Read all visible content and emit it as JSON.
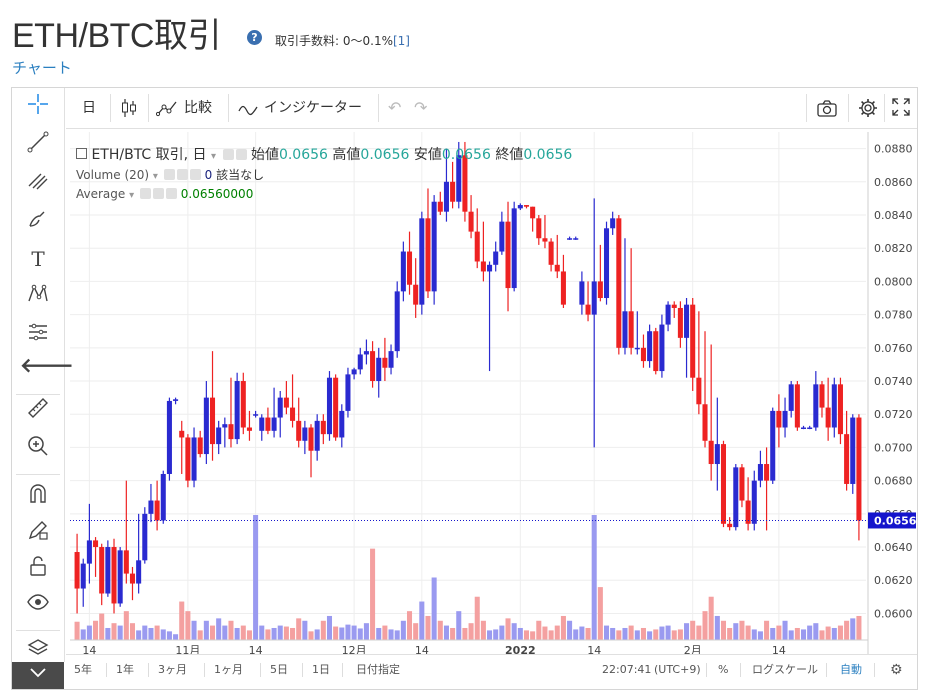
{
  "header": {
    "pair_title": "ETH/BTC取引",
    "help_icon": "?",
    "fee_label": "取引手数料: 0～0.1%",
    "fee_ref": "[1]",
    "chart_link": "チャート"
  },
  "toolbar": {
    "interval": "日",
    "compare": "比較",
    "indicators": "インジケーター"
  },
  "legend": {
    "symbol": "ETH/BTC 取引, 日",
    "open_label": "始値",
    "open_value": "0.0656",
    "high_label": "高値",
    "high_value": "0.0656",
    "low_label": "安値",
    "low_value": "0.0656",
    "close_label": "終値",
    "close_value": "0.0656",
    "volume_label": "Volume (20)",
    "volume_value": "0",
    "volume_na": "該当なし",
    "average_label": "Average",
    "average_value": "0.06560000"
  },
  "bottombar": {
    "ranges": [
      "5年",
      "1年",
      "3ヶ月",
      "1ヶ月",
      "5日",
      "1日"
    ],
    "date_range": "日付指定",
    "time": "22:07:41",
    "timezone": "(UTC+9)",
    "percent": "%",
    "log_scale": "ログスケール",
    "auto": "自動"
  },
  "colors": {
    "up": "#2a2ad0",
    "down": "#ee2222",
    "vol_up": "#9a9af0",
    "vol_down": "#f4a0a0",
    "last_price_tag": "#1515cc",
    "link": "#2a7fc0"
  },
  "chart_data": {
    "type": "candlestick",
    "y_range": [
      0.0584,
      0.089
    ],
    "y_ticks": [
      "0.0880",
      "0.0860",
      "0.0840",
      "0.0820",
      "0.0800",
      "0.0780",
      "0.0760",
      "0.0740",
      "0.0720",
      "0.0700",
      "0.0680",
      "0.0660",
      "0.0640",
      "0.0620",
      "0.0600"
    ],
    "last_price": "0.0656",
    "x_ticks": [
      "14",
      "11月",
      "14",
      "12月",
      "14",
      "2022",
      "14",
      "2月",
      "14"
    ],
    "candles": [
      {
        "o": 0.0637,
        "h": 0.0648,
        "l": 0.06,
        "c": 0.0615,
        "v": 38
      },
      {
        "o": 0.0615,
        "h": 0.0633,
        "l": 0.0604,
        "c": 0.063,
        "v": 22
      },
      {
        "o": 0.063,
        "h": 0.0666,
        "l": 0.0618,
        "c": 0.0644,
        "v": 30
      },
      {
        "o": 0.0644,
        "h": 0.0646,
        "l": 0.0622,
        "c": 0.064,
        "v": 40
      },
      {
        "o": 0.064,
        "h": 0.0642,
        "l": 0.0605,
        "c": 0.0612,
        "v": 55
      },
      {
        "o": 0.0612,
        "h": 0.0644,
        "l": 0.061,
        "c": 0.064,
        "v": 25
      },
      {
        "o": 0.064,
        "h": 0.0645,
        "l": 0.06,
        "c": 0.0606,
        "v": 35
      },
      {
        "o": 0.0606,
        "h": 0.064,
        "l": 0.0604,
        "c": 0.0638,
        "v": 30
      },
      {
        "o": 0.0638,
        "h": 0.068,
        "l": 0.0618,
        "c": 0.0624,
        "v": 60
      },
      {
        "o": 0.0624,
        "h": 0.0628,
        "l": 0.0608,
        "c": 0.0618,
        "v": 35
      },
      {
        "o": 0.0618,
        "h": 0.066,
        "l": 0.0612,
        "c": 0.0632,
        "v": 20
      },
      {
        "o": 0.0632,
        "h": 0.0664,
        "l": 0.063,
        "c": 0.066,
        "v": 30
      },
      {
        "o": 0.066,
        "h": 0.0678,
        "l": 0.0655,
        "c": 0.0668,
        "v": 25
      },
      {
        "o": 0.0668,
        "h": 0.068,
        "l": 0.065,
        "c": 0.0656,
        "v": 30
      },
      {
        "o": 0.0656,
        "h": 0.0686,
        "l": 0.0654,
        "c": 0.0684,
        "v": 22
      },
      {
        "o": 0.0684,
        "h": 0.073,
        "l": 0.068,
        "c": 0.0728,
        "v": 18
      },
      {
        "o": 0.0728,
        "h": 0.073,
        "l": 0.0726,
        "c": 0.0729,
        "v": 12
      },
      {
        "o": 0.071,
        "h": 0.0716,
        "l": 0.0684,
        "c": 0.0706,
        "v": 80
      },
      {
        "o": 0.0706,
        "h": 0.0708,
        "l": 0.0676,
        "c": 0.068,
        "v": 60
      },
      {
        "o": 0.068,
        "h": 0.0712,
        "l": 0.0676,
        "c": 0.0706,
        "v": 40
      },
      {
        "o": 0.0706,
        "h": 0.071,
        "l": 0.0694,
        "c": 0.0696,
        "v": 20
      },
      {
        "o": 0.0696,
        "h": 0.074,
        "l": 0.069,
        "c": 0.073,
        "v": 40
      },
      {
        "o": 0.073,
        "h": 0.0758,
        "l": 0.0692,
        "c": 0.0702,
        "v": 30
      },
      {
        "o": 0.0702,
        "h": 0.0716,
        "l": 0.0696,
        "c": 0.0712,
        "v": 45
      },
      {
        "o": 0.0712,
        "h": 0.0718,
        "l": 0.07,
        "c": 0.0714,
        "v": 30
      },
      {
        "o": 0.0714,
        "h": 0.0742,
        "l": 0.07,
        "c": 0.0705,
        "v": 40
      },
      {
        "o": 0.0705,
        "h": 0.0745,
        "l": 0.0702,
        "c": 0.074,
        "v": 25
      },
      {
        "o": 0.074,
        "h": 0.0745,
        "l": 0.0708,
        "c": 0.0712,
        "v": 30
      },
      {
        "o": 0.0712,
        "h": 0.0722,
        "l": 0.0704,
        "c": 0.071,
        "v": 20
      },
      {
        "o": 0.072,
        "h": 0.0722,
        "l": 0.0718,
        "c": 0.072,
        "v": 260
      },
      {
        "o": 0.071,
        "h": 0.072,
        "l": 0.0704,
        "c": 0.0718,
        "v": 30
      },
      {
        "o": 0.0718,
        "h": 0.0724,
        "l": 0.0708,
        "c": 0.071,
        "v": 22
      },
      {
        "o": 0.071,
        "h": 0.0736,
        "l": 0.0706,
        "c": 0.0718,
        "v": 25
      },
      {
        "o": 0.0718,
        "h": 0.0734,
        "l": 0.0706,
        "c": 0.073,
        "v": 30
      },
      {
        "o": 0.073,
        "h": 0.074,
        "l": 0.072,
        "c": 0.0724,
        "v": 28
      },
      {
        "o": 0.0724,
        "h": 0.0744,
        "l": 0.0712,
        "c": 0.0716,
        "v": 25
      },
      {
        "o": 0.0716,
        "h": 0.073,
        "l": 0.07,
        "c": 0.0704,
        "v": 45
      },
      {
        "o": 0.0704,
        "h": 0.0716,
        "l": 0.0696,
        "c": 0.0712,
        "v": 40
      },
      {
        "o": 0.0712,
        "h": 0.0714,
        "l": 0.0682,
        "c": 0.0698,
        "v": 18
      },
      {
        "o": 0.0698,
        "h": 0.072,
        "l": 0.0692,
        "c": 0.0716,
        "v": 22
      },
      {
        "o": 0.0716,
        "h": 0.072,
        "l": 0.0702,
        "c": 0.0708,
        "v": 40
      },
      {
        "o": 0.0708,
        "h": 0.0746,
        "l": 0.0704,
        "c": 0.0742,
        "v": 50
      },
      {
        "o": 0.0742,
        "h": 0.0744,
        "l": 0.0704,
        "c": 0.0706,
        "v": 28
      },
      {
        "o": 0.0706,
        "h": 0.0726,
        "l": 0.07,
        "c": 0.0722,
        "v": 26
      },
      {
        "o": 0.0722,
        "h": 0.0748,
        "l": 0.0718,
        "c": 0.0744,
        "v": 32
      },
      {
        "o": 0.0744,
        "h": 0.0748,
        "l": 0.0741,
        "c": 0.0747,
        "v": 30
      },
      {
        "o": 0.0747,
        "h": 0.076,
        "l": 0.0744,
        "c": 0.0756,
        "v": 24
      },
      {
        "o": 0.0756,
        "h": 0.0765,
        "l": 0.075,
        "c": 0.0758,
        "v": 35
      },
      {
        "o": 0.0758,
        "h": 0.0764,
        "l": 0.0736,
        "c": 0.074,
        "v": 190
      },
      {
        "o": 0.074,
        "h": 0.076,
        "l": 0.073,
        "c": 0.0754,
        "v": 25
      },
      {
        "o": 0.0754,
        "h": 0.0766,
        "l": 0.074,
        "c": 0.0748,
        "v": 30
      },
      {
        "o": 0.0748,
        "h": 0.0762,
        "l": 0.0744,
        "c": 0.0758,
        "v": 22
      },
      {
        "o": 0.0758,
        "h": 0.08,
        "l": 0.0754,
        "c": 0.0794,
        "v": 20
      },
      {
        "o": 0.0794,
        "h": 0.0824,
        "l": 0.0788,
        "c": 0.0818,
        "v": 40
      },
      {
        "o": 0.0818,
        "h": 0.083,
        "l": 0.0792,
        "c": 0.0798,
        "v": 60
      },
      {
        "o": 0.0798,
        "h": 0.0814,
        "l": 0.0778,
        "c": 0.0786,
        "v": 35
      },
      {
        "o": 0.0786,
        "h": 0.0842,
        "l": 0.078,
        "c": 0.0838,
        "v": 80
      },
      {
        "o": 0.0838,
        "h": 0.0856,
        "l": 0.079,
        "c": 0.0794,
        "v": 50
      },
      {
        "o": 0.0794,
        "h": 0.0852,
        "l": 0.0786,
        "c": 0.0848,
        "v": 130
      },
      {
        "o": 0.0848,
        "h": 0.0854,
        "l": 0.084,
        "c": 0.0842,
        "v": 40
      },
      {
        "o": 0.0842,
        "h": 0.088,
        "l": 0.0836,
        "c": 0.086,
        "v": 30
      },
      {
        "o": 0.086,
        "h": 0.0872,
        "l": 0.0844,
        "c": 0.0848,
        "v": 25
      },
      {
        "o": 0.0848,
        "h": 0.0884,
        "l": 0.0844,
        "c": 0.0876,
        "v": 60
      },
      {
        "o": 0.0876,
        "h": 0.0884,
        "l": 0.0836,
        "c": 0.0842,
        "v": 25
      },
      {
        "o": 0.0842,
        "h": 0.0852,
        "l": 0.0826,
        "c": 0.083,
        "v": 35
      },
      {
        "o": 0.083,
        "h": 0.0844,
        "l": 0.0808,
        "c": 0.0812,
        "v": 90
      },
      {
        "o": 0.0812,
        "h": 0.0836,
        "l": 0.08,
        "c": 0.0806,
        "v": 40
      },
      {
        "o": 0.0806,
        "h": 0.0812,
        "l": 0.0746,
        "c": 0.081,
        "v": 20
      },
      {
        "o": 0.081,
        "h": 0.0824,
        "l": 0.0806,
        "c": 0.0818,
        "v": 22
      },
      {
        "o": 0.0818,
        "h": 0.0842,
        "l": 0.0816,
        "c": 0.0836,
        "v": 30
      },
      {
        "o": 0.0836,
        "h": 0.0848,
        "l": 0.0782,
        "c": 0.0796,
        "v": 45
      },
      {
        "o": 0.0796,
        "h": 0.0848,
        "l": 0.0794,
        "c": 0.0844,
        "v": 35
      },
      {
        "o": 0.0844,
        "h": 0.0847,
        "l": 0.0843,
        "c": 0.0846,
        "v": 25
      },
      {
        "o": 0.0846,
        "h": 0.0846,
        "l": 0.0844,
        "c": 0.0845,
        "v": 20
      },
      {
        "o": 0.0845,
        "h": 0.0845,
        "l": 0.083,
        "c": 0.0838,
        "v": 18
      },
      {
        "o": 0.0838,
        "h": 0.084,
        "l": 0.0822,
        "c": 0.0826,
        "v": 40
      },
      {
        "o": 0.0826,
        "h": 0.084,
        "l": 0.082,
        "c": 0.0824,
        "v": 28
      },
      {
        "o": 0.0824,
        "h": 0.0826,
        "l": 0.0806,
        "c": 0.081,
        "v": 20
      },
      {
        "o": 0.081,
        "h": 0.0828,
        "l": 0.0802,
        "c": 0.0806,
        "v": 30
      },
      {
        "o": 0.0806,
        "h": 0.0816,
        "l": 0.0784,
        "c": 0.0786,
        "v": 50
      },
      {
        "o": 0.0826,
        "h": 0.0827,
        "l": 0.0825,
        "c": 0.0826,
        "v": 40
      },
      {
        "o": 0.0826,
        "h": 0.0827,
        "l": 0.0825,
        "c": 0.0826,
        "v": 22
      },
      {
        "o": 0.0786,
        "h": 0.0806,
        "l": 0.078,
        "c": 0.08,
        "v": 28
      },
      {
        "o": 0.0786,
        "h": 0.08,
        "l": 0.0776,
        "c": 0.078,
        "v": 25
      },
      {
        "o": 0.078,
        "h": 0.085,
        "l": 0.07,
        "c": 0.08,
        "v": 260
      },
      {
        "o": 0.08,
        "h": 0.0822,
        "l": 0.0788,
        "c": 0.079,
        "v": 110
      },
      {
        "o": 0.079,
        "h": 0.0836,
        "l": 0.0786,
        "c": 0.0832,
        "v": 30
      },
      {
        "o": 0.0832,
        "h": 0.0842,
        "l": 0.0828,
        "c": 0.0838,
        "v": 25
      },
      {
        "o": 0.0838,
        "h": 0.084,
        "l": 0.0756,
        "c": 0.076,
        "v": 20
      },
      {
        "o": 0.076,
        "h": 0.0826,
        "l": 0.0756,
        "c": 0.0782,
        "v": 25
      },
      {
        "o": 0.0782,
        "h": 0.082,
        "l": 0.0756,
        "c": 0.076,
        "v": 30
      },
      {
        "o": 0.076,
        "h": 0.0782,
        "l": 0.0756,
        "c": 0.076,
        "v": 20
      },
      {
        "o": 0.076,
        "h": 0.0768,
        "l": 0.0748,
        "c": 0.0752,
        "v": 25
      },
      {
        "o": 0.0752,
        "h": 0.0774,
        "l": 0.0748,
        "c": 0.077,
        "v": 18
      },
      {
        "o": 0.077,
        "h": 0.0772,
        "l": 0.0744,
        "c": 0.0746,
        "v": 22
      },
      {
        "o": 0.0746,
        "h": 0.078,
        "l": 0.0742,
        "c": 0.0774,
        "v": 28
      },
      {
        "o": 0.0774,
        "h": 0.0788,
        "l": 0.077,
        "c": 0.0786,
        "v": 30
      },
      {
        "o": 0.0786,
        "h": 0.0788,
        "l": 0.0778,
        "c": 0.0784,
        "v": 20
      },
      {
        "o": 0.0784,
        "h": 0.0788,
        "l": 0.076,
        "c": 0.0766,
        "v": 22
      },
      {
        "o": 0.0766,
        "h": 0.079,
        "l": 0.0742,
        "c": 0.0786,
        "v": 35
      },
      {
        "o": 0.0786,
        "h": 0.079,
        "l": 0.0734,
        "c": 0.0742,
        "v": 40
      },
      {
        "o": 0.0742,
        "h": 0.0782,
        "l": 0.072,
        "c": 0.0726,
        "v": 30
      },
      {
        "o": 0.0726,
        "h": 0.077,
        "l": 0.07,
        "c": 0.0704,
        "v": 60
      },
      {
        "o": 0.0704,
        "h": 0.0762,
        "l": 0.068,
        "c": 0.069,
        "v": 90
      },
      {
        "o": 0.069,
        "h": 0.073,
        "l": 0.0674,
        "c": 0.0702,
        "v": 50
      },
      {
        "o": 0.0702,
        "h": 0.0704,
        "l": 0.0652,
        "c": 0.0654,
        "v": 40
      },
      {
        "o": 0.0654,
        "h": 0.0658,
        "l": 0.065,
        "c": 0.0652,
        "v": 25
      },
      {
        "o": 0.0652,
        "h": 0.069,
        "l": 0.065,
        "c": 0.0688,
        "v": 35
      },
      {
        "o": 0.0688,
        "h": 0.069,
        "l": 0.0664,
        "c": 0.0668,
        "v": 40
      },
      {
        "o": 0.0668,
        "h": 0.0682,
        "l": 0.065,
        "c": 0.0654,
        "v": 30
      },
      {
        "o": 0.0654,
        "h": 0.0686,
        "l": 0.065,
        "c": 0.068,
        "v": 22
      },
      {
        "o": 0.068,
        "h": 0.0698,
        "l": 0.0676,
        "c": 0.069,
        "v": 18
      },
      {
        "o": 0.069,
        "h": 0.07,
        "l": 0.065,
        "c": 0.068,
        "v": 40
      },
      {
        "o": 0.068,
        "h": 0.0724,
        "l": 0.0678,
        "c": 0.0722,
        "v": 25
      },
      {
        "o": 0.0722,
        "h": 0.0732,
        "l": 0.07,
        "c": 0.0712,
        "v": 30
      },
      {
        "o": 0.0712,
        "h": 0.073,
        "l": 0.0706,
        "c": 0.0722,
        "v": 40
      },
      {
        "o": 0.0722,
        "h": 0.074,
        "l": 0.0718,
        "c": 0.0738,
        "v": 20
      },
      {
        "o": 0.0738,
        "h": 0.074,
        "l": 0.071,
        "c": 0.0712,
        "v": 25
      },
      {
        "o": 0.0712,
        "h": 0.0713,
        "l": 0.0711,
        "c": 0.0712,
        "v": 22
      },
      {
        "o": 0.0712,
        "h": 0.0713,
        "l": 0.0711,
        "c": 0.0712,
        "v": 30
      },
      {
        "o": 0.0712,
        "h": 0.0746,
        "l": 0.071,
        "c": 0.0738,
        "v": 35
      },
      {
        "o": 0.0738,
        "h": 0.074,
        "l": 0.0718,
        "c": 0.0724,
        "v": 20
      },
      {
        "o": 0.0724,
        "h": 0.0742,
        "l": 0.0704,
        "c": 0.0712,
        "v": 28
      },
      {
        "o": 0.0712,
        "h": 0.0742,
        "l": 0.0706,
        "c": 0.0738,
        "v": 25
      },
      {
        "o": 0.0738,
        "h": 0.0742,
        "l": 0.0702,
        "c": 0.0708,
        "v": 30
      },
      {
        "o": 0.0708,
        "h": 0.0722,
        "l": 0.0674,
        "c": 0.0678,
        "v": 40
      },
      {
        "o": 0.0678,
        "h": 0.072,
        "l": 0.0672,
        "c": 0.0718,
        "v": 45
      },
      {
        "o": 0.0718,
        "h": 0.072,
        "l": 0.0644,
        "c": 0.0656,
        "v": 50
      }
    ]
  }
}
